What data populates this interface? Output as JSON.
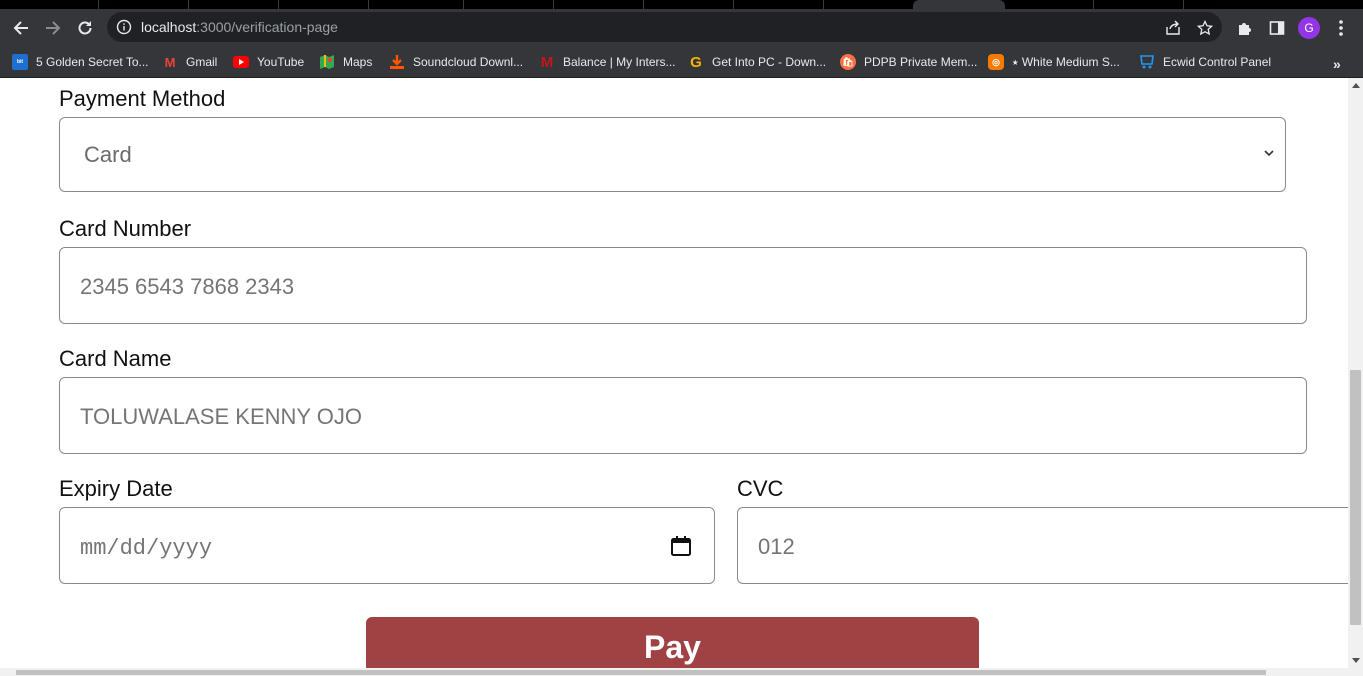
{
  "browser": {
    "url_host": "localhost",
    "url_rest": ":3000/verification-page",
    "profile_initial": "G",
    "bookmarks": [
      {
        "label": "5 Golden Secret To...",
        "icon": "bitdegree-icon",
        "color": "#1f6fd1"
      },
      {
        "label": "Gmail",
        "icon": "gmail-icon",
        "color": "#ea4335"
      },
      {
        "label": "YouTube",
        "icon": "youtube-icon",
        "color": "#ff0000"
      },
      {
        "label": "Maps",
        "icon": "maps-icon",
        "color": "#34a853"
      },
      {
        "label": "Soundcloud Downl...",
        "icon": "download-icon",
        "color": "#ff5500"
      },
      {
        "label": "Balance | My Inters...",
        "icon": "m-icon",
        "color": "#c4161c"
      },
      {
        "label": "Get Into PC - Down...",
        "icon": "g-icon",
        "color": "#f4b400"
      },
      {
        "label": "PDPB Private Mem...",
        "icon": "shop-icon",
        "color": "#ff7043"
      },
      {
        "label": "⭑ White Medium S...",
        "icon": "badge-icon",
        "color": "#f57c00"
      },
      {
        "label": "Ecwid Control Panel",
        "icon": "ecwid-icon",
        "color": "#2196f3"
      }
    ]
  },
  "form": {
    "payment_method_label": "Payment Method",
    "payment_method_value": "Card",
    "card_number_label": "Card Number",
    "card_number_placeholder": "2345 6543 7868 2343",
    "card_name_label": "Card Name",
    "card_name_placeholder": "TOLUWALASE KENNY OJO",
    "expiry_label": "Expiry Date",
    "expiry_placeholder": "mm/dd/yyyy",
    "cvc_label": "CVC",
    "cvc_placeholder": "012",
    "pay_label": "Pay"
  },
  "colors": {
    "pay_button": "#a04244"
  }
}
